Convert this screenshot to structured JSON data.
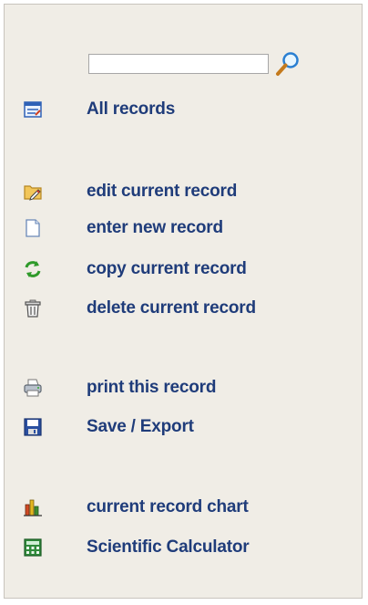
{
  "search": {
    "placeholder": "",
    "value": ""
  },
  "menu": {
    "all_records": "All records",
    "edit_current": "edit current record",
    "enter_new": "enter new record",
    "copy_current": "copy current record",
    "delete_current": "delete current record",
    "print_record": "print this record",
    "save_export": "Save / Export",
    "record_chart": "current record chart",
    "sci_calc": "Scientific Calculator"
  },
  "colors": {
    "link": "#1f3c7a",
    "panel_bg": "#f0ede6",
    "border": "#c8c4bd"
  }
}
